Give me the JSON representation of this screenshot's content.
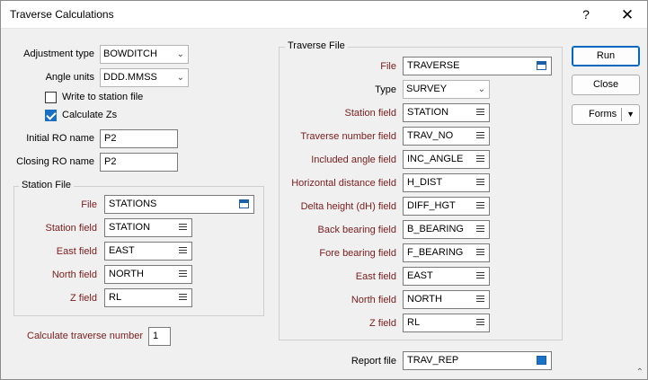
{
  "window": {
    "title": "Traverse Calculations",
    "help": "?",
    "close": "✕"
  },
  "left": {
    "adjustment_type": {
      "label": "Adjustment type",
      "value": "BOWDITCH"
    },
    "angle_units": {
      "label": "Angle units",
      "value": "DDD.MMSS"
    },
    "write_station": {
      "label": "Write to station file",
      "checked": false
    },
    "calculate_zs": {
      "label": "Calculate Zs",
      "checked": true
    },
    "initial_ro": {
      "label": "Initial RO name",
      "value": "P2"
    },
    "closing_ro": {
      "label": "Closing RO name",
      "value": "P2"
    },
    "station_file": {
      "title": "Station File",
      "file": {
        "label": "File",
        "value": "STATIONS"
      },
      "station_field": {
        "label": "Station field",
        "value": "STATION"
      },
      "east_field": {
        "label": "East field",
        "value": "EAST"
      },
      "north_field": {
        "label": "North field",
        "value": "NORTH"
      },
      "z_field": {
        "label": "Z field",
        "value": "RL"
      }
    },
    "calc_traverse": {
      "label": "Calculate traverse number",
      "value": "1"
    }
  },
  "traverse": {
    "title": "Traverse File",
    "file": {
      "label": "File",
      "value": "TRAVERSE"
    },
    "type": {
      "label": "Type",
      "value": "SURVEY"
    },
    "station_field": {
      "label": "Station field",
      "value": "STATION"
    },
    "traverse_number": {
      "label": "Traverse number field",
      "value": "TRAV_NO"
    },
    "included_angle": {
      "label": "Included angle field",
      "value": "INC_ANGLE"
    },
    "horizontal_distance": {
      "label": "Horizontal distance field",
      "value": "H_DIST"
    },
    "delta_height": {
      "label": "Delta height (dH) field",
      "value": "DIFF_HGT"
    },
    "back_bearing": {
      "label": "Back bearing field",
      "value": "B_BEARING"
    },
    "fore_bearing": {
      "label": "Fore bearing field",
      "value": "F_BEARING"
    },
    "east_field": {
      "label": "East field",
      "value": "EAST"
    },
    "north_field": {
      "label": "North field",
      "value": "NORTH"
    },
    "z_field": {
      "label": "Z field",
      "value": "RL"
    }
  },
  "report": {
    "label": "Report file",
    "value": "TRAV_REP"
  },
  "buttons": {
    "run": "Run",
    "close": "Close",
    "forms": "Forms"
  }
}
